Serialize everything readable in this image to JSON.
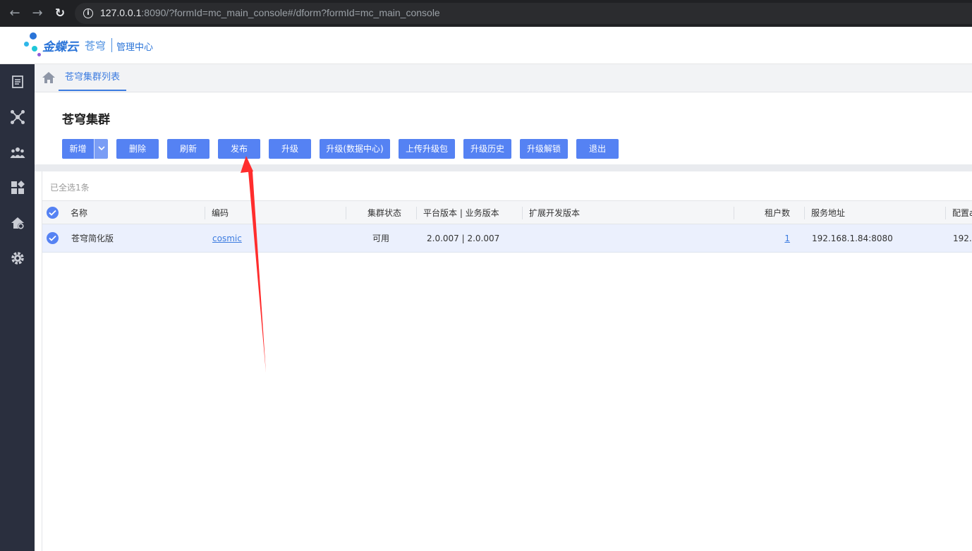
{
  "browser": {
    "url_host": "127.0.0.1",
    "url_rest": ":8090/?formId=mc_main_console#/dform?formId=mc_main_console"
  },
  "header": {
    "brand": "金蝶云",
    "product": "苍穹",
    "center": "管理中心"
  },
  "sidebar": {
    "items": [
      {
        "icon": "document-list-icon"
      },
      {
        "icon": "cluster-network-icon"
      },
      {
        "icon": "users-group-icon"
      },
      {
        "icon": "apps-grid-icon"
      },
      {
        "icon": "home-gear-icon"
      },
      {
        "icon": "gear-icon"
      }
    ]
  },
  "tabs": {
    "active": "苍穹集群列表"
  },
  "page": {
    "title": "苍穹集群"
  },
  "toolbar": {
    "new": "新增",
    "delete": "删除",
    "refresh": "刷新",
    "publish": "发布",
    "upgrade": "升级",
    "upgrade_dc": "升级(数据中心)",
    "upload_pkg": "上传升级包",
    "upgrade_history": "升级历史",
    "upgrade_unlock": "升级解锁",
    "exit": "退出"
  },
  "grid": {
    "selection_info": "已全选1条",
    "headers": {
      "name": "名称",
      "code": "编码",
      "status": "集群状态",
      "version": "平台版本 | 业务版本",
      "ext_version": "扩展开发版本",
      "tenants": "租户数",
      "service_addr": "服务地址",
      "config": "配置a"
    },
    "rows": [
      {
        "name": "苍穹简化版",
        "code": "cosmic",
        "status": "可用",
        "version": "2.0.007 |  2.0.007",
        "ext_version": "",
        "tenants": "1",
        "service_addr": "192.168.1.84:8080",
        "config": "192.1"
      }
    ]
  },
  "colors": {
    "accent": "#5582f3",
    "sidebar": "#2a2f3e",
    "annotation": "#ff2d2d"
  }
}
